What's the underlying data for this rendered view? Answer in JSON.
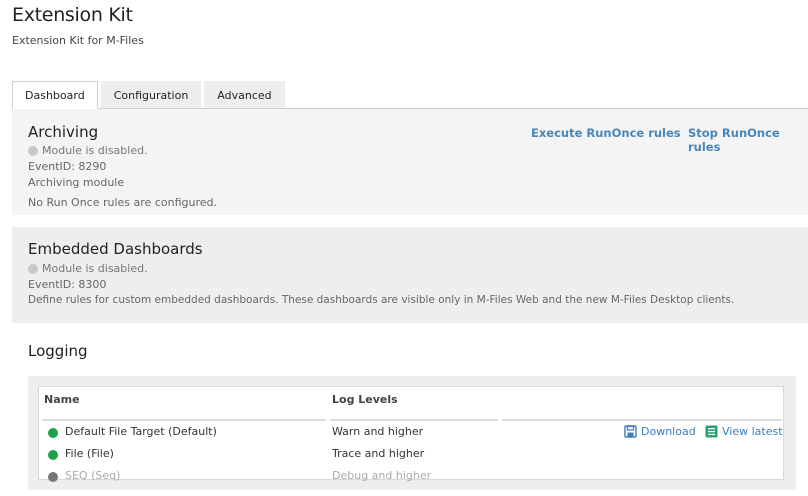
{
  "app": {
    "title": "Extension Kit",
    "subtitle": "Extension Kit for M-Files"
  },
  "tabs": [
    {
      "label": "Dashboard",
      "active": true
    },
    {
      "label": "Configuration",
      "active": false
    },
    {
      "label": "Advanced",
      "active": false
    }
  ],
  "archiving": {
    "title": "Archiving",
    "status": "Module is disabled.",
    "event_id": "EventID: 8290",
    "description": "Archiving module",
    "note": "No Run Once rules are configured.",
    "execute_label": "Execute RunOnce rules",
    "stop_label": "Stop RunOnce rules"
  },
  "embedded": {
    "title": "Embedded Dashboards",
    "status": "Module is disabled.",
    "event_id": "EventID: 8300",
    "description": "Define rules for custom embedded dashboards. These dashboards are visible only in M-Files Web and the new M-Files Desktop clients."
  },
  "logging": {
    "title": "Logging",
    "columns": {
      "name": "Name",
      "levels": "Log Levels"
    },
    "rows": [
      {
        "name": "Default File Target (Default)",
        "level": "Warn and higher",
        "status_color": "#1aa34a",
        "enabled": true
      },
      {
        "name": "File (File)",
        "level": "Trace and higher",
        "status_color": "#1aa34a",
        "enabled": true
      },
      {
        "name": "SEQ (Seq)",
        "level": "Debug and higher",
        "status_color": "#777777",
        "enabled": false
      }
    ],
    "download_label": "Download",
    "view_latest_label": "View latest",
    "download_icon": "save-icon",
    "view_latest_icon": "list-icon"
  },
  "colors": {
    "link": "#4a86b8",
    "enabled_dot": "#1aa34a",
    "disabled_dot": "#c8c8c8"
  }
}
